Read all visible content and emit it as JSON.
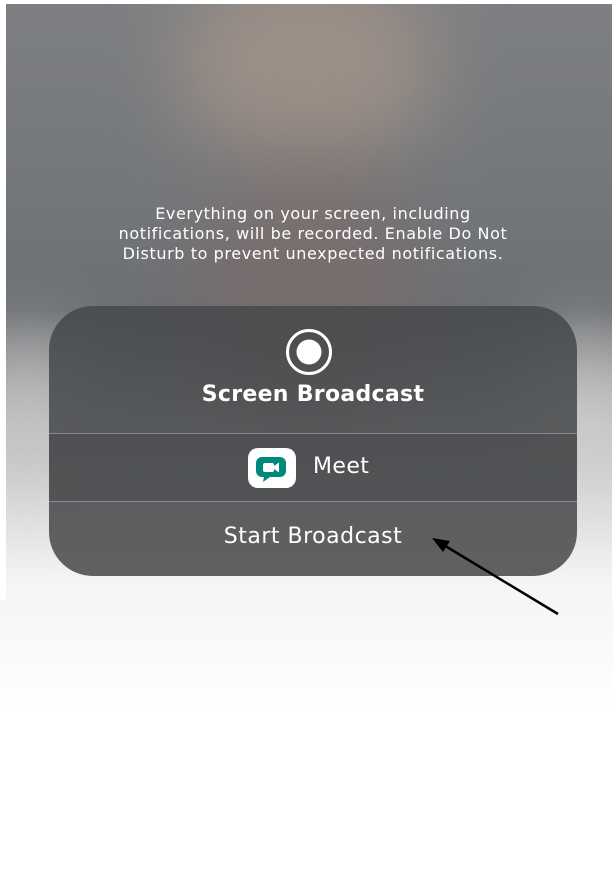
{
  "info": {
    "lines": [
      "Everything on your screen, including",
      "notifications, will be recorded. Enable Do Not",
      "Disturb to prevent unexpected notifications."
    ]
  },
  "sheet": {
    "title": "Screen Broadcast",
    "app_name": "Meet",
    "start_label": "Start Broadcast",
    "record_icon": "record-icon",
    "app_icon": "google-meet-icon"
  },
  "annotation": {
    "pointer": "arrow-annotation"
  },
  "colors": {
    "sheet_bg": "#46484a",
    "text": "#ffffff",
    "meet_green": "#00897b",
    "meet_teal": "#00796b",
    "arrow": "#000000"
  }
}
